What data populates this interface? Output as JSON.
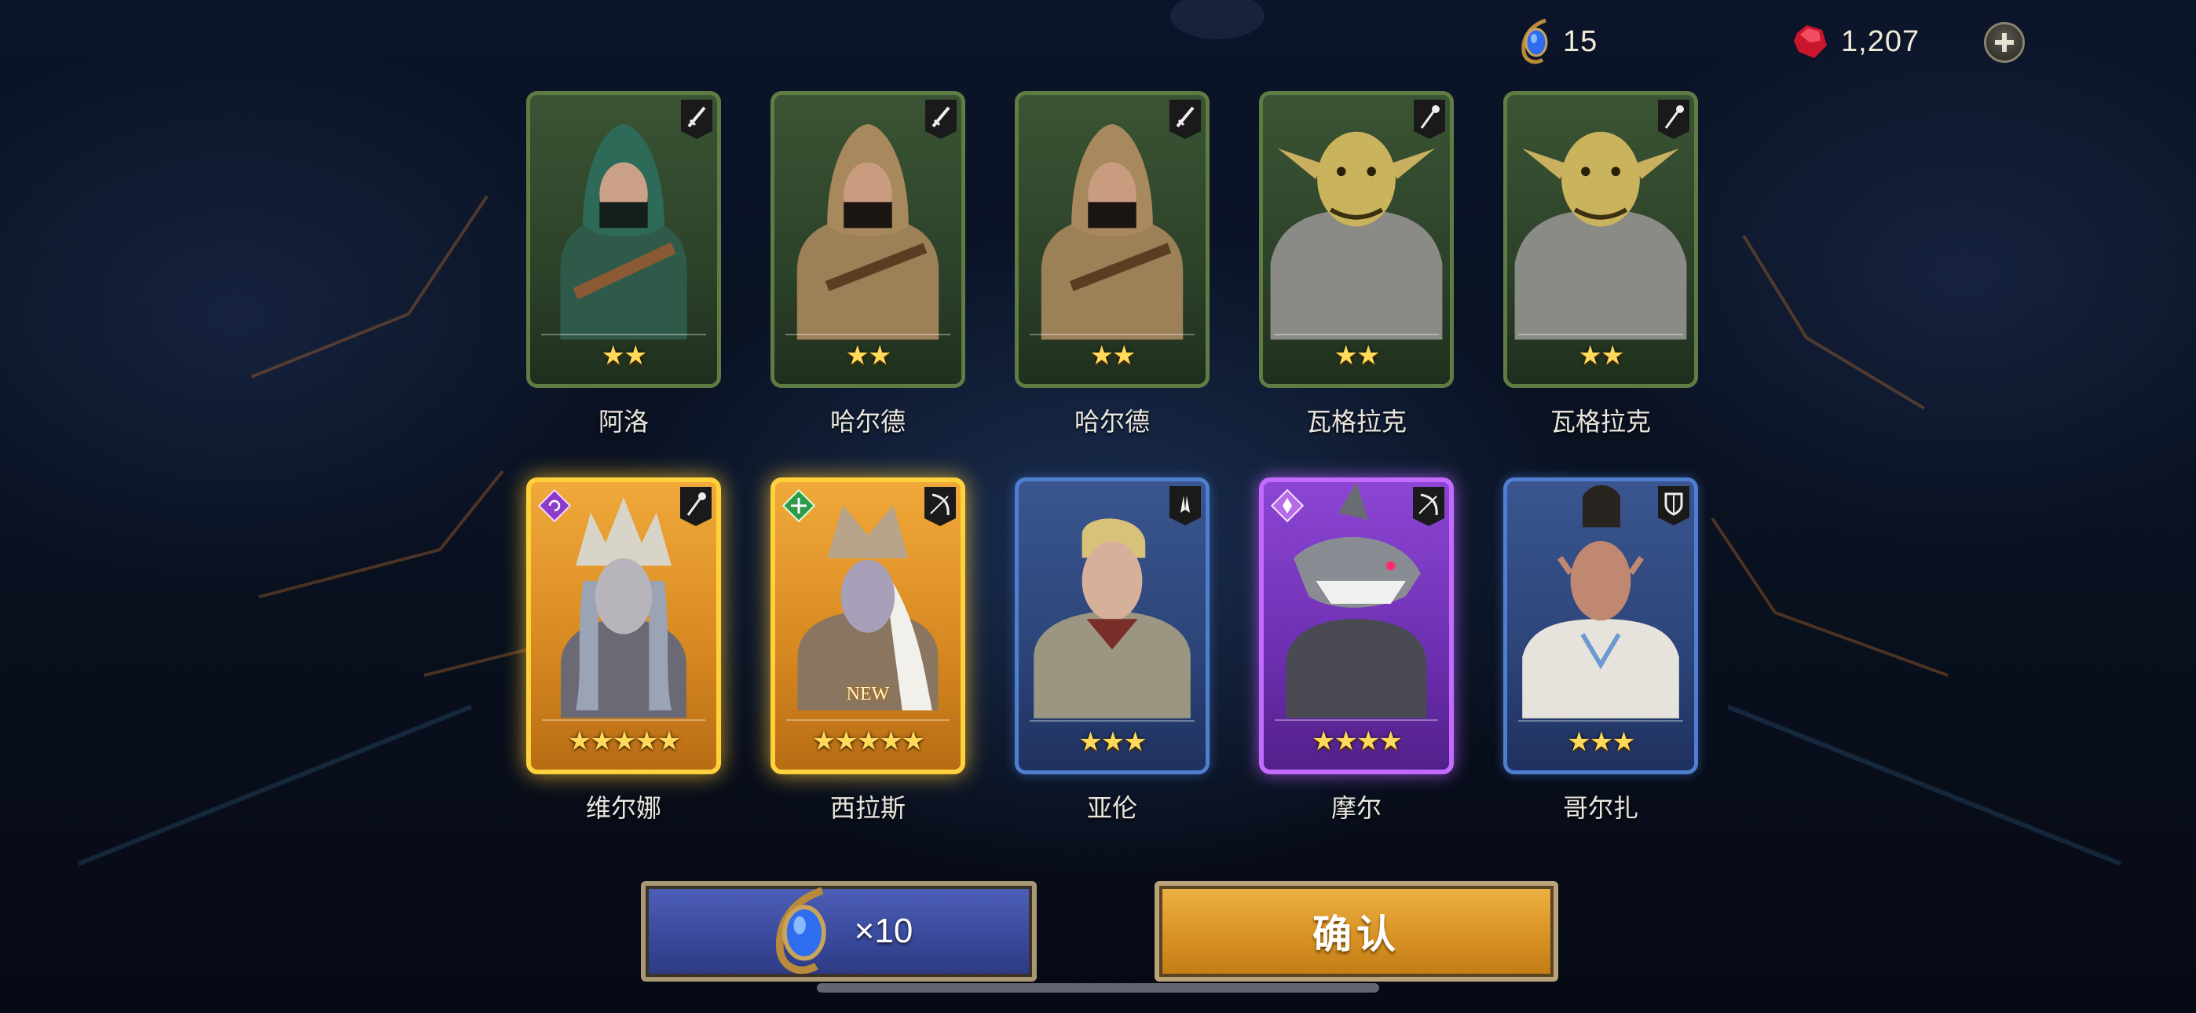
{
  "currency": {
    "summon_gem_count": "15",
    "ruby_count": "1,207"
  },
  "colors": {
    "green_rarity": "#5f7c45",
    "legendary_gold": "#ffd23c",
    "rare_blue": "#4f7fd0",
    "epic_purple": "#c46bff",
    "confirm_gold": "#d89224",
    "summon_blue": "#3a4a9c"
  },
  "heroes": [
    {
      "name": "阿洛",
      "stars": "★★",
      "rarity": "green",
      "class_icon": "dagger-icon"
    },
    {
      "name": "哈尔德",
      "stars": "★★",
      "rarity": "green",
      "class_icon": "dagger-icon"
    },
    {
      "name": "哈尔德",
      "stars": "★★",
      "rarity": "green",
      "class_icon": "dagger-icon"
    },
    {
      "name": "瓦格拉克",
      "stars": "★★",
      "rarity": "green",
      "class_icon": "staff-icon"
    },
    {
      "name": "瓦格拉克",
      "stars": "★★",
      "rarity": "green",
      "class_icon": "staff-icon"
    },
    {
      "name": "维尔娜",
      "stars": "★★★★★",
      "rarity": "gold",
      "class_icon": "staff-icon",
      "faction_icon": "swirl-icon"
    },
    {
      "name": "西拉斯",
      "stars": "★★★★★",
      "rarity": "gold",
      "class_icon": "bow-icon",
      "faction_icon": "leaf-diamond-icon",
      "badge": "NEW"
    },
    {
      "name": "亚伦",
      "stars": "★★★",
      "rarity": "blue",
      "class_icon": "praying-hands-icon"
    },
    {
      "name": "摩尔",
      "stars": "★★★★",
      "rarity": "purple",
      "class_icon": "bow-icon",
      "faction_icon": "crystal-icon"
    },
    {
      "name": "哥尔扎",
      "stars": "★★★",
      "rarity": "blue",
      "class_icon": "shield-icon"
    }
  ],
  "buttons": {
    "summon_again_label": "×10",
    "confirm_label": "确认"
  }
}
